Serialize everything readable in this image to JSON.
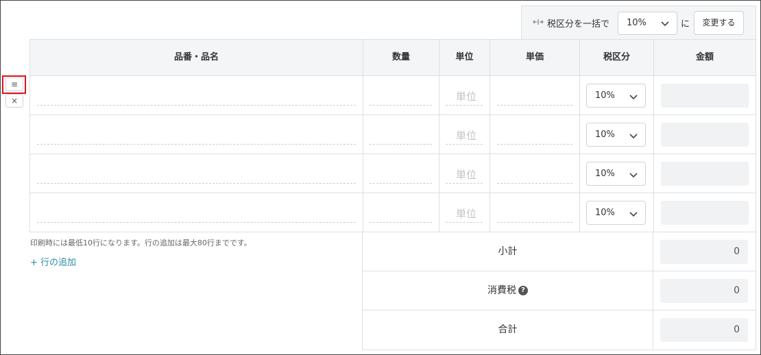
{
  "toolbar": {
    "bulk_label": "税区分を一括で",
    "bulk_rate": "10%",
    "ni": "に",
    "change_button": "変更する"
  },
  "columns": [
    "品番・品名",
    "数量",
    "単位",
    "単価",
    "税区分",
    "金額"
  ],
  "rows": [
    {
      "unit_placeholder": "単位",
      "tax": "10%"
    },
    {
      "unit_placeholder": "単位",
      "tax": "10%"
    },
    {
      "unit_placeholder": "単位",
      "tax": "10%"
    },
    {
      "unit_placeholder": "単位",
      "tax": "10%"
    }
  ],
  "row_controls": {
    "menu_glyph": "≡",
    "delete_glyph": "×"
  },
  "footer": {
    "note": "印刷時には最低10行になります。行の追加は最大80行までです。",
    "add_row": "+ 行の追加"
  },
  "summary": {
    "subtotal_label": "小計",
    "subtotal_value": "0",
    "tax_label": "消費税",
    "tax_help": "?",
    "tax_value": "0",
    "total_label": "合計",
    "total_value": "0"
  },
  "icons": {
    "bulk": "arrows-merge-icon",
    "chevron": "chevron-down-icon",
    "help": "question-circle-icon"
  },
  "colors": {
    "header_bg": "#f4f5f6",
    "link": "#2b8aa0",
    "highlight": "#e0101a"
  }
}
